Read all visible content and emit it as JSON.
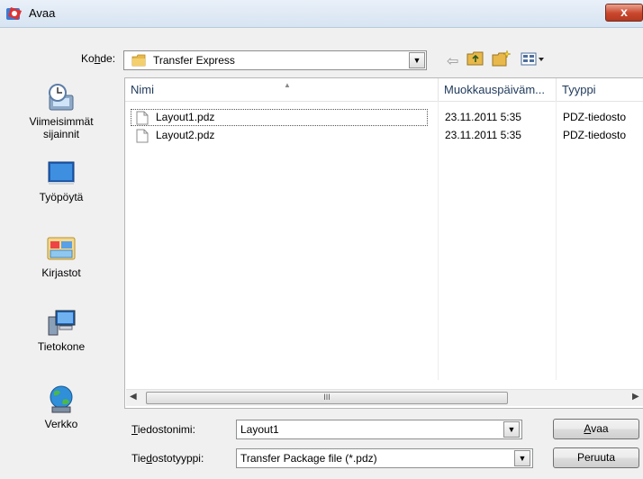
{
  "window": {
    "title": "Avaa",
    "close_glyph": "x"
  },
  "lookin": {
    "label_pre": "Ko",
    "label_key": "h",
    "label_post": "de:",
    "value": "Transfer Express"
  },
  "places": [
    {
      "label_line1": "Viimeisimmät",
      "label_line2": "sijainnit",
      "icon": "recent-places-icon"
    },
    {
      "label_line1": "Työpöytä",
      "label_line2": "",
      "icon": "desktop-icon"
    },
    {
      "label_line1": "Kirjastot",
      "label_line2": "",
      "icon": "libraries-icon"
    },
    {
      "label_line1": "Tietokone",
      "label_line2": "",
      "icon": "computer-icon"
    },
    {
      "label_line1": "Verkko",
      "label_line2": "",
      "icon": "network-icon"
    }
  ],
  "filelist": {
    "columns": [
      "Nimi",
      "Muokkauspäiväm...",
      "Tyyppi"
    ],
    "rows": [
      {
        "name": "Layout1.pdz",
        "date": "23.11.2011 5:35",
        "type": "PDZ-tiedosto",
        "selected": true
      },
      {
        "name": "Layout2.pdz",
        "date": "23.11.2011 5:35",
        "type": "PDZ-tiedosto",
        "selected": false
      }
    ],
    "scroll_thumb_grip": "III"
  },
  "filename": {
    "label_key": "T",
    "label_rest": "iedostonimi:",
    "value": "Layout1"
  },
  "filetype": {
    "label_pre": "Tie",
    "label_key": "d",
    "label_post": "ostotyyppi:",
    "value": "Transfer Package file (*.pdz)"
  },
  "buttons": {
    "open_key": "A",
    "open_rest": "vaa",
    "cancel": "Peruuta"
  },
  "colors": {
    "close_red": "#c9462b",
    "selection_outline": "#555555",
    "header_text": "#1e395b"
  }
}
